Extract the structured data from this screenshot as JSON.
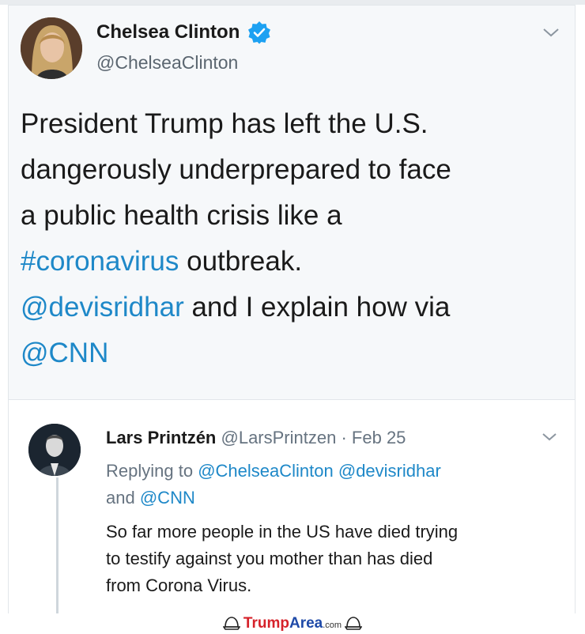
{
  "tweet": {
    "name": "Chelsea Clinton",
    "handle": "@ChelseaClinton",
    "body_line1": "President Trump has left the U.S.",
    "body_line2": "dangerously underprepared to face",
    "body_line3": "a public health crisis like a",
    "hashtag": "#coronavirus",
    "body_after_hashtag": " outbreak.",
    "mention1": "@devisridhar",
    "body_after_mention": " and I explain how via",
    "mention2": "@CNN",
    "verified_icon": "verified-badge-icon",
    "menu_icon": "chevron-down-icon"
  },
  "reply": {
    "name": "Lars Printzén",
    "handle": "@LarsPrintzen",
    "separator": "·",
    "date": "Feb 25",
    "replying_prefix": "Replying to",
    "replying_mention1": "@ChelseaClinton",
    "replying_mention2": "@devisridhar",
    "replying_and": "and",
    "replying_mention3": "@CNN",
    "body_line1": "So far more people in the US have died trying",
    "body_line2": "to testify against you mother than has died",
    "body_line3": "from Corona Virus.",
    "menu_icon": "chevron-down-icon"
  },
  "watermark": {
    "part1": "Trump",
    "part2": "Area",
    "part3": ".com",
    "icon": "cap-icon"
  },
  "colors": {
    "link": "#1e88c8",
    "verified": "#1da1f2",
    "watermark_red": "#d6222a",
    "watermark_blue": "#1f4aa8"
  }
}
